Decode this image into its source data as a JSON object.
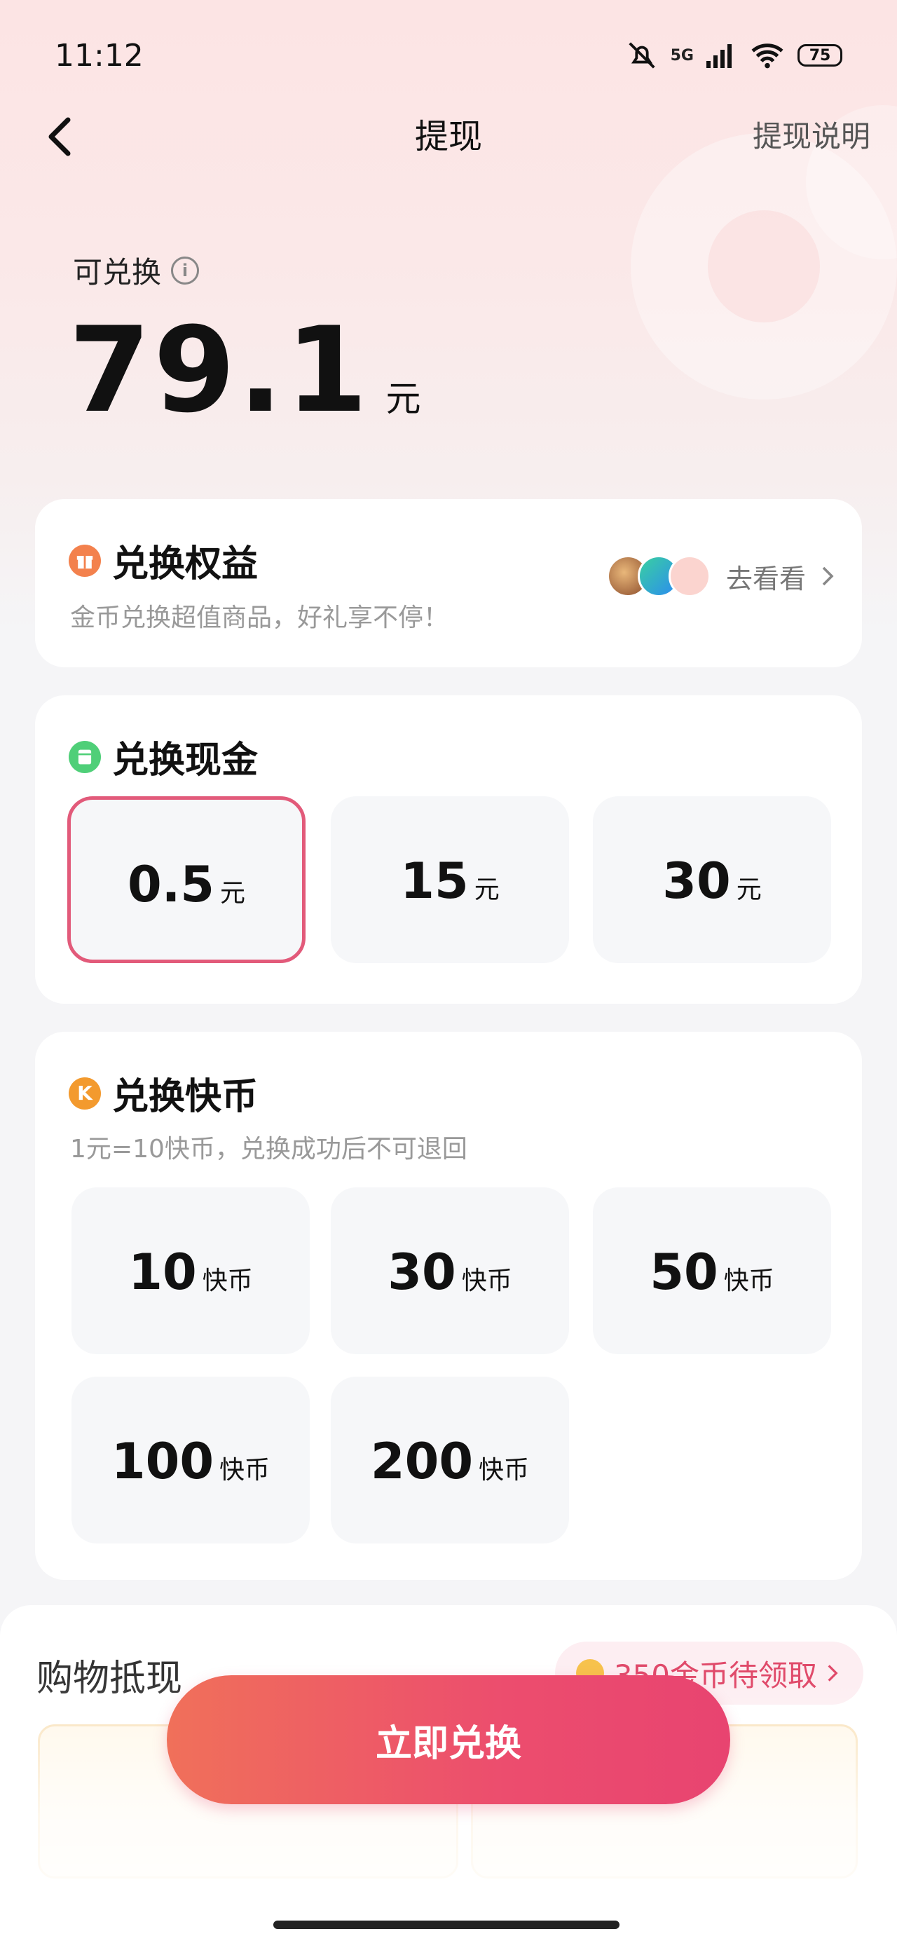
{
  "status_bar": {
    "time": "11:12",
    "battery": "75",
    "network": "5G"
  },
  "nav": {
    "title": "提现",
    "help": "提现说明"
  },
  "balance": {
    "label": "可兑换",
    "amount": "79.1",
    "unit": "元"
  },
  "rights": {
    "title": "兑换权益",
    "subtitle": "金币兑换超值商品，好礼享不停！",
    "link": "去看看"
  },
  "cash": {
    "title": "兑换现金",
    "options": [
      {
        "value": "0.5",
        "unit": "元",
        "selected": true
      },
      {
        "value": "15",
        "unit": "元"
      },
      {
        "value": "30",
        "unit": "元"
      }
    ]
  },
  "kuaibi": {
    "title": "兑换快币",
    "subtitle": "1元=10快币，兑换成功后不可退回",
    "options": [
      {
        "value": "10",
        "unit": "快币"
      },
      {
        "value": "30",
        "unit": "快币"
      },
      {
        "value": "50",
        "unit": "快币"
      },
      {
        "value": "100",
        "unit": "快币"
      },
      {
        "value": "200",
        "unit": "快币"
      }
    ]
  },
  "shopping": {
    "title": "购物抵现",
    "pill": "350金币待领取"
  },
  "cta": {
    "label": "立即兑换"
  },
  "colors": {
    "accent": "#e84470",
    "selected_border": "#e25a7a"
  }
}
